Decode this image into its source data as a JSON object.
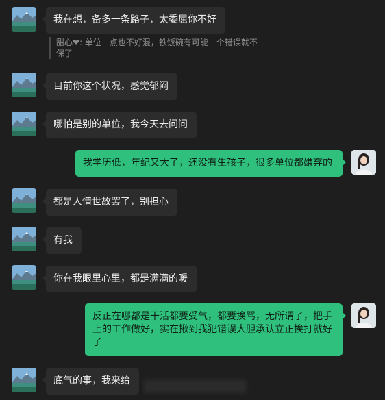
{
  "conversation": {
    "messages": [
      {
        "side": "in",
        "text": "我在想，备多一条路子，太委屈你不好"
      },
      {
        "side": "in",
        "text": "目前你这个状况，感觉郁闷"
      },
      {
        "side": "in",
        "text": "哪怕是别的单位，我今天去问问"
      },
      {
        "side": "out",
        "text": "我学历低，年纪又大了，还没有生孩子，很多单位都嫌弃的"
      },
      {
        "side": "in",
        "text": "都是人情世故罢了，别担心"
      },
      {
        "side": "in",
        "text": "有我"
      },
      {
        "side": "in",
        "text": "你在我眼里心里，都是满满的暖"
      },
      {
        "side": "out",
        "text": "反正在哪都是干活都要受气，都要挨骂，无所谓了，把手上的工作做好，实在揪到我犯错误大胆承认立正挨打就好了"
      },
      {
        "side": "in",
        "text": "底气的事，我来给"
      }
    ],
    "quote": {
      "sender": "甜心",
      "heart": "❤",
      "text": ": 单位一点也不好混，铁饭碗有可能一个错误就不保了"
    }
  },
  "colors": {
    "background": "#1e1e1e",
    "incoming_bubble": "#2c2c2c",
    "outgoing_bubble": "#2fc07e"
  },
  "avatars": {
    "contact": "landscape-lake-mountain-avatar",
    "self": "woman-portrait-avatar"
  }
}
